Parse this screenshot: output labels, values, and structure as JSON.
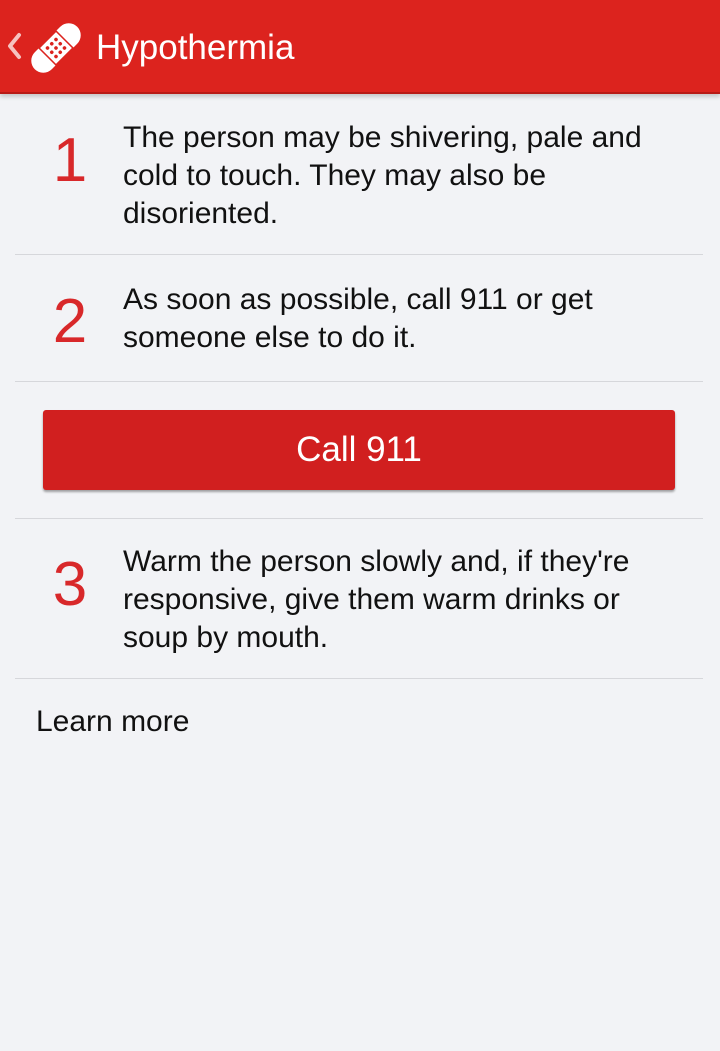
{
  "appbar": {
    "title": "Hypothermia",
    "back_icon": "chevron-left-icon",
    "app_icon": "bandage-icon",
    "background_color": "#dc231e"
  },
  "steps": [
    {
      "number": "1",
      "text": "The person may be shivering, pale and cold to touch. They may also be disoriented."
    },
    {
      "number": "2",
      "text": "As soon as possible, call 911 or get someone else to do it."
    },
    {
      "number": "3",
      "text": "Warm the person slowly and, if they're responsive, give them warm drinks or soup by mouth."
    }
  ],
  "call_button": {
    "label": "Call 911",
    "color": "#d11f1f"
  },
  "learn_more": {
    "label": "Learn more"
  }
}
